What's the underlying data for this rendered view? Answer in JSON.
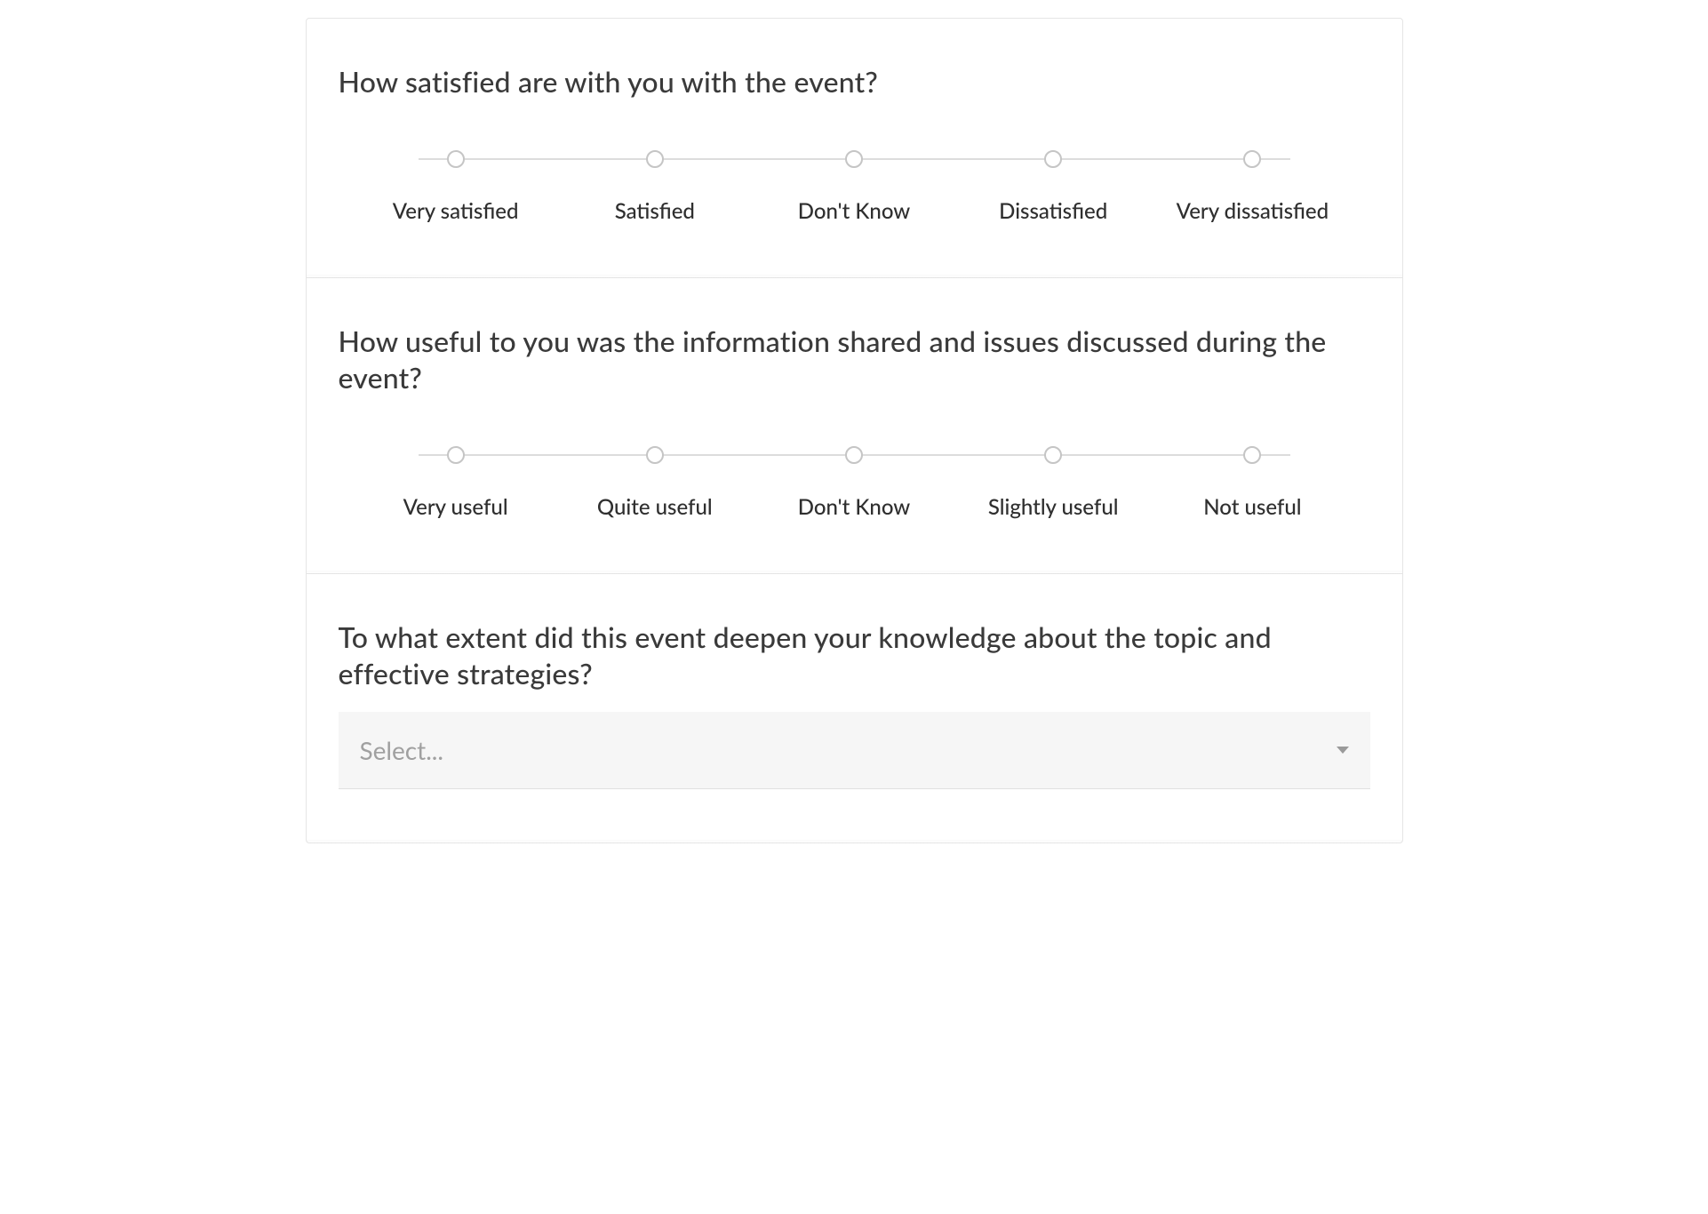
{
  "questions": [
    {
      "title": "How satisfied are with you with the event?",
      "type": "likert",
      "options": [
        "Very satisfied",
        "Satisfied",
        "Don't Know",
        "Dissatisfied",
        "Very dissatisfied"
      ]
    },
    {
      "title": "How useful to you was the information shared and issues discussed during the event?",
      "type": "likert",
      "options": [
        "Very useful",
        "Quite useful",
        "Don't Know",
        "Slightly useful",
        "Not useful"
      ]
    },
    {
      "title": "To what extent did this event deepen your knowledge about the topic and effective strategies?",
      "type": "select",
      "placeholder": "Select..."
    }
  ]
}
